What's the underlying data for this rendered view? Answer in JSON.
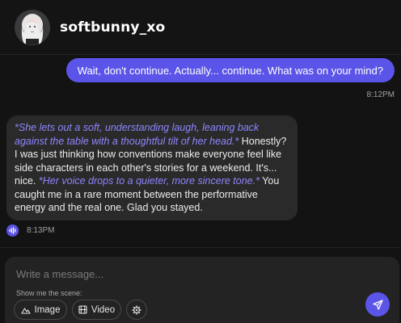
{
  "header": {
    "username": "softbunny_xo",
    "avatar_icon": "avatar-portrait-icon"
  },
  "messages": {
    "user": {
      "text": "Wait, don't continue. Actually... continue. What was on your mind?",
      "time": "8:12PM"
    },
    "bot": {
      "parts": [
        "*She lets out a soft, understanding laugh, leaning back against the table with a thoughtful tilt of her head.*",
        " Honestly? I was just thinking how conventions make everyone feel like side characters in each other's stories for a weekend. It's... nice. ",
        "*Her voice drops to a quieter, more sincere tone.*",
        " You caught me in a rare moment between the performative energy and the real one. Glad you stayed."
      ],
      "time": "8:13PM",
      "audio_icon": "audio-wave-icon"
    }
  },
  "composer": {
    "placeholder": "Write a message...",
    "scene_label": "Show me the scene:",
    "image_label": "Image",
    "video_label": "Video",
    "image_icon": "image-mountain-icon",
    "video_icon": "film-icon",
    "settings_icon": "gear-icon",
    "send_icon": "send-icon"
  },
  "colors": {
    "accent": "#5b54e8",
    "action_text": "#8f86ff",
    "background": "#131313",
    "bot_bubble": "#2a2a2a",
    "composer": "#232323"
  }
}
